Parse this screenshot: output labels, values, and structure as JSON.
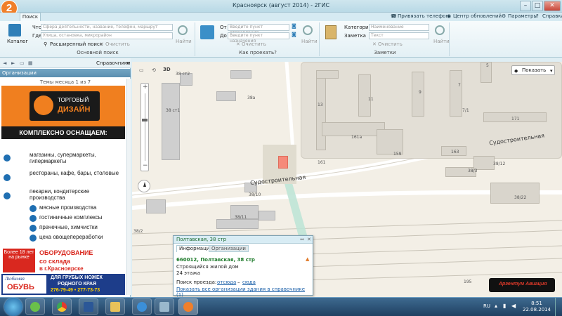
{
  "window": {
    "title": "Красноярск (август 2014) - 2ГИС",
    "app_icon": "2"
  },
  "tabs": {
    "search": "Поиск"
  },
  "top_links": {
    "call": "Привязать телефон",
    "updates": "Центр обновлений",
    "params": "Параметры",
    "help": "Справка"
  },
  "search": {
    "catalog": "Каталог",
    "what_label": "Что",
    "what_placeholder": "Сфера деятельности, название, телефон, маршрут",
    "where_label": "Где",
    "where_placeholder": "Улица, остановка, микрорайон",
    "advanced": "Расширенный поиск",
    "clear": "Очистить",
    "find": "Найти",
    "group_label": "Основной поиск"
  },
  "route": {
    "from_label": "От",
    "from_placeholder": "Введите пункт отправления",
    "to_label": "До",
    "to_placeholder": "Введите пункт назначения",
    "clear": "Очистить",
    "find": "Найти",
    "group_label": "Как проехать?"
  },
  "notes": {
    "category_label": "Категория",
    "category_placeholder": "Наименование",
    "note_label": "Заметка",
    "note_placeholder": "Текст",
    "clear": "Очистить",
    "find": "Найти",
    "group_label": "Заметки"
  },
  "sidebar": {
    "directory": "Справочники",
    "header": "Организации",
    "theme": "Темы месяца 1 из 7",
    "ad": {
      "brand1": "ТОРГОВЫЙ",
      "brand2": "ДИЗАЙН",
      "headline": "КОМПЛЕКСНО ОСНАЩАЕМ:",
      "items": [
        "магазины, супермаркеты, гипермаркеты",
        "рестораны, кафе, бары, столовые",
        "пекарни, кондитерские производства",
        "мясные производства",
        "гостиничные комплексы",
        "прачечные, химчистки",
        "цеха овощепереработки"
      ],
      "badge": "Более 18 лет на рынке",
      "equip1": "ОБОРУДОВАНИЕ",
      "equip2": "со склада",
      "equip3": "в г.Красноярске",
      "shoes1": "Любимая",
      "shoes2": "ОБУВЬ",
      "shoes3": "ДЛЯ ГРУБЫХ НОЖЕК",
      "shoes4": "РОДНОГО КРАЯ",
      "phone": "276-79-49 • 277-73-73"
    }
  },
  "map": {
    "show_btn": "Показать",
    "mode_3d": "3D",
    "streets": {
      "sudostr1": "Судостроительная",
      "sudostr2": "Судостроительная"
    },
    "labels": [
      "38 ст2",
      "38 ст1",
      "38а",
      "13",
      "11",
      "9",
      "7",
      "5",
      "7/1",
      "171",
      "161а",
      "161",
      "159",
      "163",
      "38/3",
      "38/12",
      "38/10",
      "38/11",
      "38/2",
      "38/22",
      "195"
    ],
    "logo": "Аргентум Авиация"
  },
  "popup": {
    "title": "Полтавская, 38 стр",
    "tab_info": "Информация",
    "tab_orgs": "Организации",
    "address": "660012, Полтавская, 38 стр",
    "desc1": "Строящийся жилой дом",
    "desc2": "24 этажа",
    "route_label": "Поиск проезда:",
    "route_from": "отсюда",
    "dash": "–",
    "route_to": "сюда",
    "show_orgs": "Показать все организации здания в справочнике (1)"
  },
  "taskbar": {
    "lang": "RU",
    "time": "8:51",
    "date": "22.08.2014"
  }
}
